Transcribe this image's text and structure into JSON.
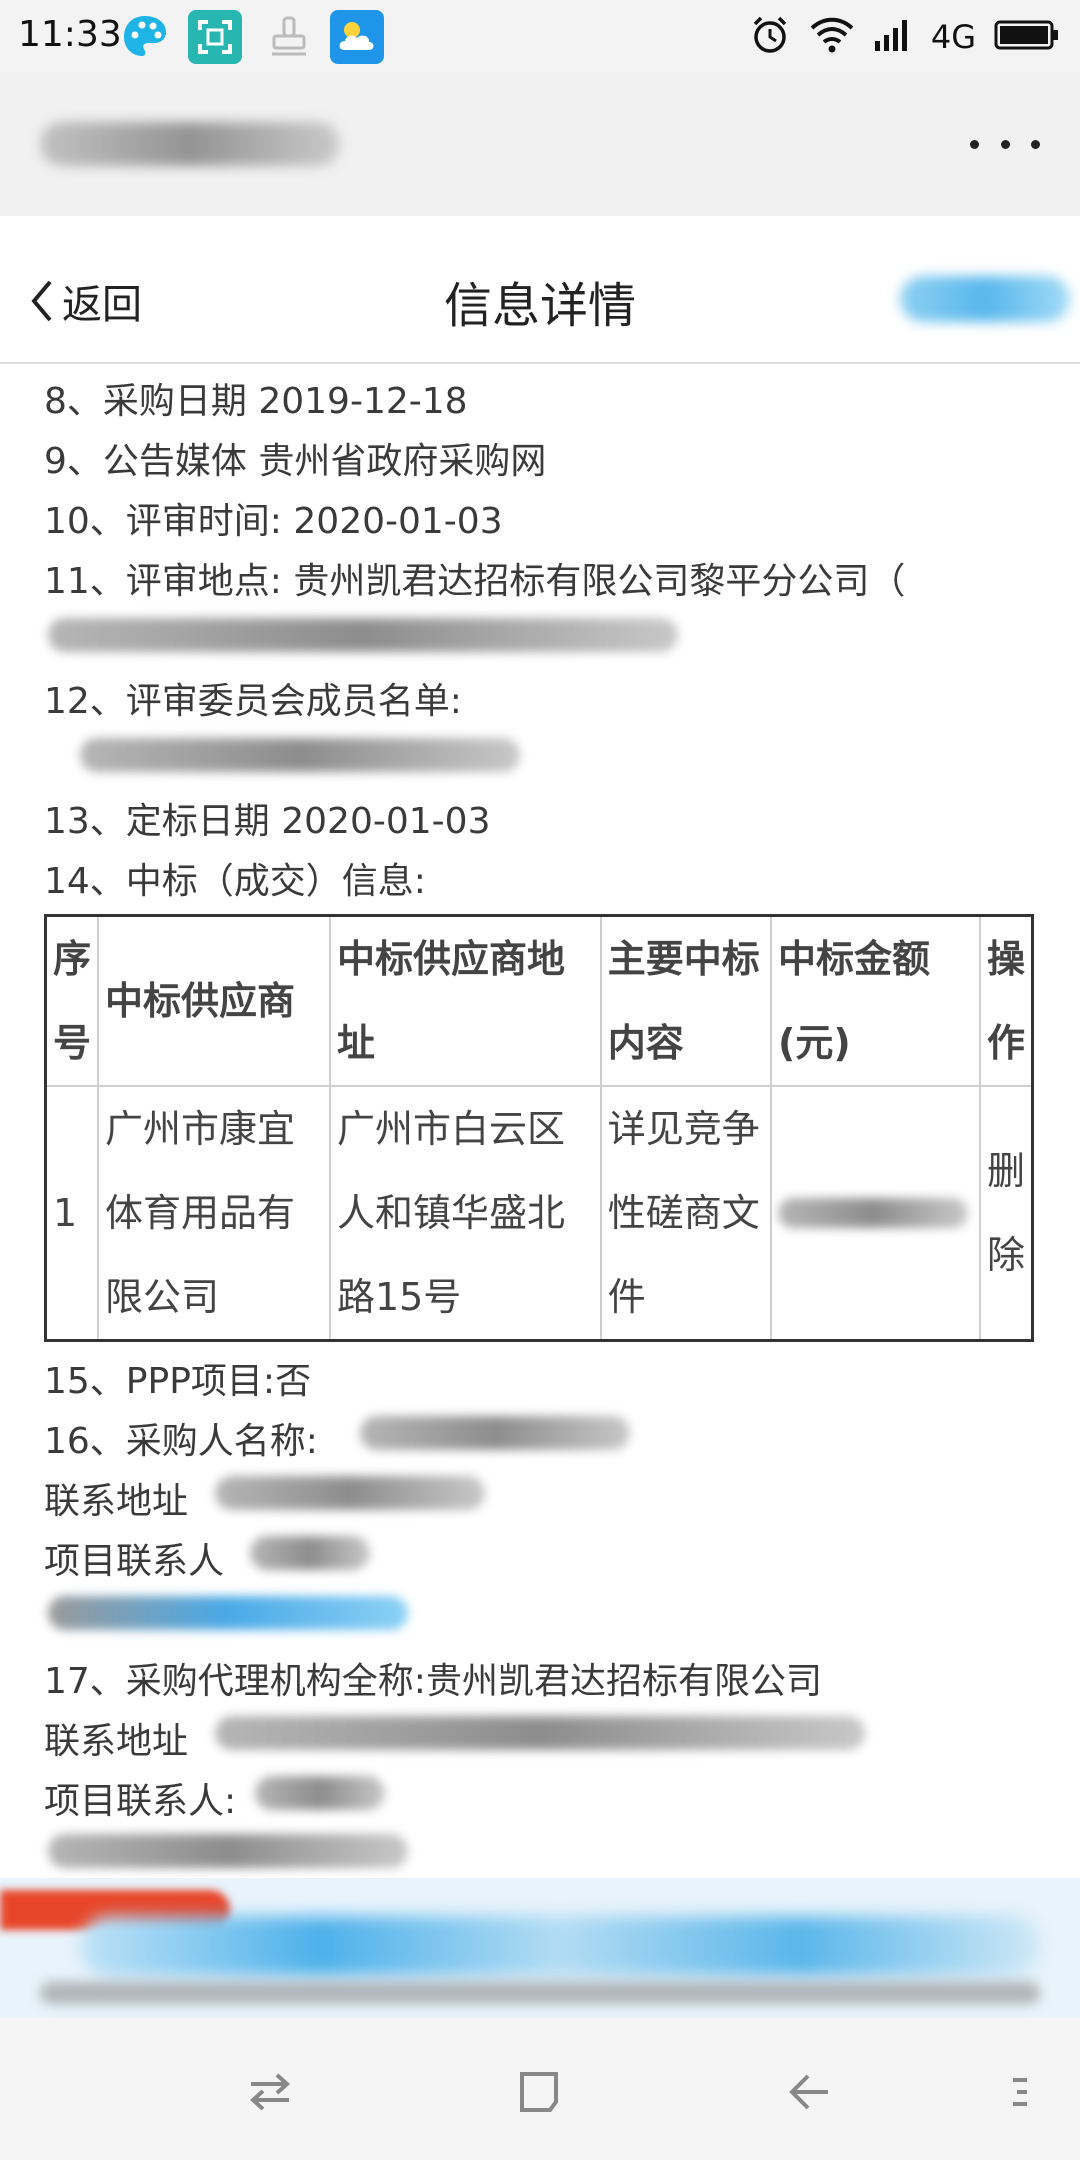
{
  "status_bar": {
    "time": "11:33",
    "network": "4G",
    "icons": [
      "palette-icon",
      "screenshot-icon",
      "stamp-icon",
      "weather-icon",
      "alarm-icon",
      "wifi-icon",
      "signal-icon",
      "battery-icon"
    ]
  },
  "header": {
    "back_label": "返回",
    "title": "信息详情"
  },
  "content": {
    "lines": {
      "purchase_date": "8、采购日期 2019-12-18",
      "media": "9、公告媒体 贵州省政府采购网",
      "review_time": "10、评审时间: 2020-01-03",
      "review_place": "11、评审地点: 贵州凯君达招标有限公司黎平分公司（",
      "committee": "12、评审委员会成员名单:",
      "award_date": "13、定标日期 2020-01-03",
      "award_info": "14、中标（成交）信息:",
      "ppp": "15、PPP项目:否",
      "purchaser": "16、采购人名称:",
      "purchaser_address": "联系地址",
      "purchaser_contact": "项目联系人",
      "agency": "17、采购代理机构全称:贵州凯君达招标有限公司",
      "agency_address": "联系地址",
      "agency_contact": "项目联系人:"
    },
    "table": {
      "headers": [
        "序号",
        "中标供应商",
        "中标供应商地址",
        "主要中标内容",
        "中标金额(元)",
        "操作"
      ],
      "rows": [
        {
          "no": "1",
          "supplier": "广州市康宜体育用品有限公司",
          "address": "广州市白云区人和镇华盛北路15号",
          "content": "详见竞争性磋商文件",
          "amount": "",
          "action": "删除"
        }
      ]
    }
  },
  "nav_bar": {
    "icons": [
      "switch-icon",
      "recents-icon",
      "back-arrow-icon",
      "menu-icon"
    ]
  }
}
